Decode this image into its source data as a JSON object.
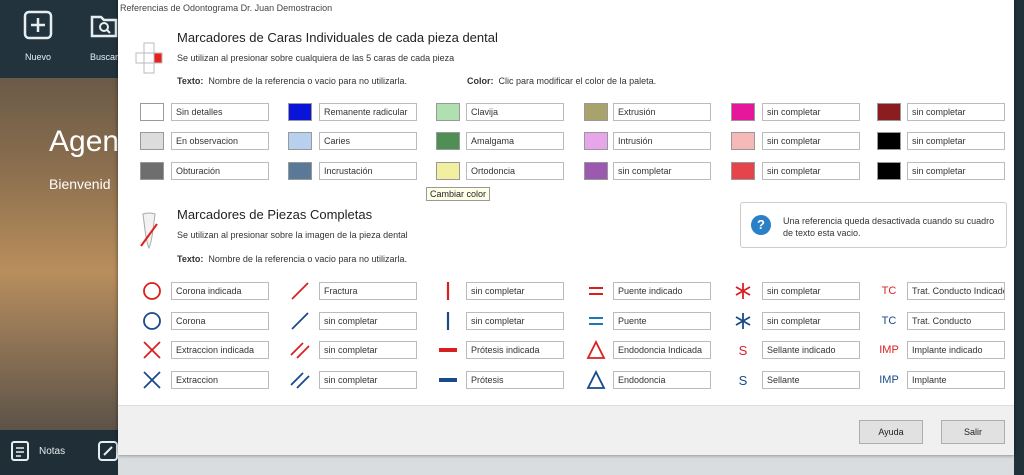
{
  "sidebar": {
    "nuevo": "Nuevo",
    "buscar": "Buscar",
    "notas": "Notas"
  },
  "background": {
    "title": "Agend",
    "subtitle": "Bienvenid"
  },
  "dialog": {
    "title": "Referencias de Odontograma   Dr. Juan Demostracion",
    "section1": {
      "title": "Marcadores de Caras Individuales de cada pieza dental",
      "subtitle": "Se utilizan al presionar sobre cualquiera de las 5 caras de cada pieza",
      "text_label": "Texto:",
      "text_hint": "Nombre de la referencia o vacio para no utilizarla.",
      "color_label": "Color:",
      "color_hint": "Clic para modificar el color de la paleta."
    },
    "faces": [
      {
        "color": "#ffffff",
        "label": "Sin detalles"
      },
      {
        "color": "#dcdcdc",
        "label": "En observacion"
      },
      {
        "color": "#6e6e6e",
        "label": "Obturación"
      },
      {
        "color": "#0a14d8",
        "label": "Remanente radicular"
      },
      {
        "color": "#b7d0ee",
        "label": "Caries"
      },
      {
        "color": "#5a7898",
        "label": "Incrustación"
      },
      {
        "color": "#b0dfb0",
        "label": "Clavija"
      },
      {
        "color": "#4f8f55",
        "label": "Amalgama"
      },
      {
        "color": "#f2efa0",
        "label": "Ortodoncia"
      },
      {
        "color": "#a9a26c",
        "label": "Extrusión"
      },
      {
        "color": "#e8a6ea",
        "label": "Intrusión"
      },
      {
        "color": "#9b59b0",
        "label": "sin completar"
      },
      {
        "color": "#e5179a",
        "label": "sin completar"
      },
      {
        "color": "#f6b9b8",
        "label": "sin completar"
      },
      {
        "color": "#e5454a",
        "label": "sin completar"
      },
      {
        "color": "#8b1c20",
        "label": "sin completar"
      },
      {
        "color": "#000000",
        "label": "sin completar"
      },
      {
        "color": "#000000",
        "label": "sin completar"
      }
    ],
    "tooltip": "Cambiar color",
    "section2": {
      "title": "Marcadores de Piezas Completas",
      "subtitle": "Se utilizan al presionar sobre la imagen de la pieza dental",
      "text_label": "Texto:",
      "text_hint": "Nombre de la referencia o vacio para no utilizarla."
    },
    "info": {
      "icon": "question-icon",
      "text": "Una referencia queda desactivada cuando su cuadro de texto esta vacio."
    },
    "pieces": [
      {
        "icon": "circle-icon",
        "color": "#d92020",
        "label": "Corona indicada"
      },
      {
        "icon": "circle-icon",
        "color": "#1a4a8a",
        "label": "Corona"
      },
      {
        "icon": "x-cross-icon",
        "color": "#d92020",
        "label": "Extraccion indicada"
      },
      {
        "icon": "x-cross-icon",
        "color": "#1a4a8a",
        "label": "Extraccion"
      },
      {
        "icon": "slash-icon",
        "color": "#d92020",
        "label": "Fractura"
      },
      {
        "icon": "slash-icon",
        "color": "#1a4a8a",
        "label": "sin completar"
      },
      {
        "icon": "double-slash-icon",
        "color": "#d92020",
        "label": "sin completar"
      },
      {
        "icon": "double-slash-icon",
        "color": "#1a4a8a",
        "label": "sin completar"
      },
      {
        "icon": "vertical-bar-icon",
        "color": "#d92020",
        "label": "sin completar"
      },
      {
        "icon": "vertical-bar-icon",
        "color": "#1a4a8a",
        "label": "sin completar"
      },
      {
        "icon": "horizontal-bar-icon",
        "color": "#d92020",
        "label": "Prótesis indicada"
      },
      {
        "icon": "horizontal-bar-icon",
        "color": "#1a4a8a",
        "label": "Prótesis"
      },
      {
        "icon": "equals-icon",
        "color": "#d92020",
        "label": "Puente indicado"
      },
      {
        "icon": "equals-icon",
        "color": "#1a7ab8",
        "label": "Puente"
      },
      {
        "icon": "triangle-icon",
        "color": "#d92020",
        "label": "Endodoncia Indicada"
      },
      {
        "icon": "triangle-icon",
        "color": "#1a4a8a",
        "label": "Endodoncia"
      },
      {
        "icon": "asterisk-icon",
        "color": "#d92020",
        "label": "sin completar"
      },
      {
        "icon": "asterisk-icon",
        "color": "#1a4a8a",
        "label": "sin completar"
      },
      {
        "icon": "s-letter-icon",
        "color": "#d92020",
        "label": "Sellante indicado",
        "glyph": "S"
      },
      {
        "icon": "s-letter-icon",
        "color": "#1a4a8a",
        "label": "Sellante",
        "glyph": "S"
      },
      {
        "icon": "tc-text-icon",
        "color": "#d92020",
        "label": "Trat. Conducto Indicado",
        "glyph": "TC"
      },
      {
        "icon": "tc-text-icon",
        "color": "#1a4a8a",
        "label": "Trat. Conducto",
        "glyph": "TC"
      },
      {
        "icon": "imp-text-icon",
        "color": "#d92020",
        "label": "Implante indicado",
        "glyph": "IMP"
      },
      {
        "icon": "imp-text-icon",
        "color": "#1a4a8a",
        "label": "Implante",
        "glyph": "IMP"
      }
    ],
    "buttons": {
      "ayuda": "Ayuda",
      "salir": "Salir"
    }
  }
}
